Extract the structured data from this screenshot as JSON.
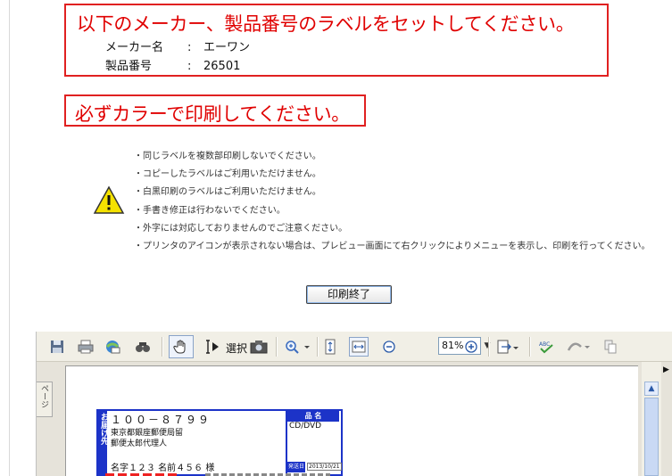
{
  "instruction": {
    "title": "以下のメーカー、製品番号のラベルをセットしてください。",
    "maker_label": "メーカー名",
    "maker_value": "エーワン",
    "product_label": "製品番号",
    "product_value": "26501",
    "separator": ":"
  },
  "color_notice": "必ずカラーで印刷してください。",
  "notes": [
    "・同じラベルを複数部印刷しないでください。",
    "・コピーしたラベルはご利用いただけません。",
    "・白黒印刷のラベルはご利用いただけません。",
    "・手書き修正は行わないでください。",
    "・外字には対応しておりませんのでご注意ください。",
    "・プリンタのアイコンが表示されない場合は、プレビュー画面にて右クリックによりメニューを表示し、印刷を行ってください。"
  ],
  "done_button": "印刷終了",
  "viewer": {
    "select_label": "選択",
    "zoom": "81%",
    "side_tab": "ページ",
    "toolbar_icons": [
      "save-icon",
      "print-icon",
      "email-icon",
      "find-icon",
      "hand-tool-icon",
      "select-text-icon",
      "snapshot-icon",
      "zoom-in-icon",
      "fit-page-icon",
      "fit-width-icon",
      "zoom-out-icon",
      "zoom-in-plus-icon",
      "page-options-icon",
      "spellcheck-icon",
      "sign-icon",
      "copy-icon"
    ]
  },
  "label_preview": {
    "side_text": "お届け先",
    "zip": "１００－８７９９",
    "address_line1": "東京都銀座郵便局留",
    "address_line2": "郵便太郎代理人",
    "name": "名字１２３ 名前４５６ 様",
    "product_header": "品 名",
    "product_value": "CD/DVD",
    "date_tag": "発送日",
    "date": "2013/10/21"
  },
  "colors": {
    "accent_red": "#e00000",
    "label_blue": "#1c33c8"
  }
}
